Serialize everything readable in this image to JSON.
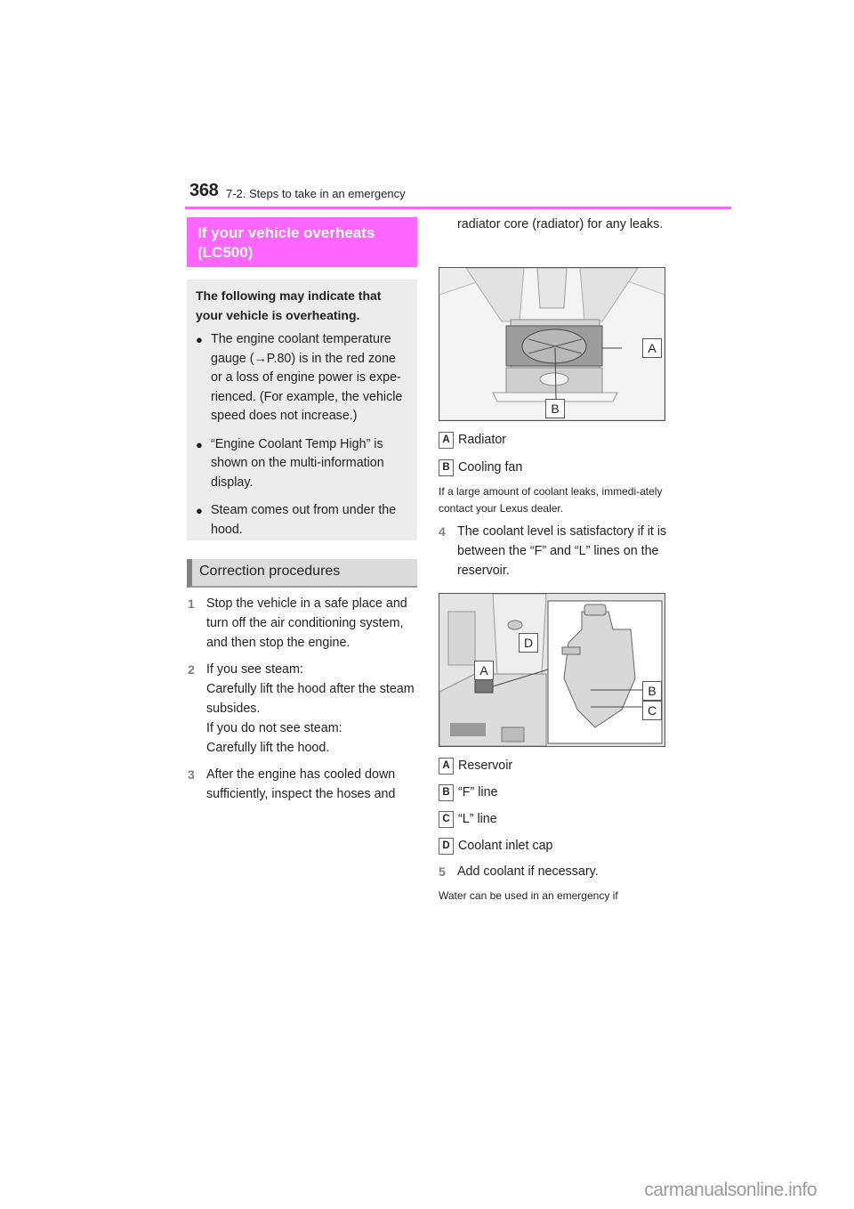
{
  "header": {
    "page_number": "368",
    "section": "7-2. Steps to take in an emergency",
    "accent_color": "#ff66ff"
  },
  "left": {
    "title": "If your vehicle overheats (LC500)",
    "title_line1": "If your vehicle overheats",
    "title_line2": "(LC500)",
    "intro": "The following may indicate that your vehicle is overheating.",
    "bullets": [
      "The engine coolant temperature gauge (→P.80) is in the red zone or a loss of engine power is expe-rienced. (For example, the vehicle speed does not increase.)",
      "“Engine Coolant Temp High” is shown on the multi-information display.",
      "Steam comes out from under the hood."
    ],
    "bullet_icon": "bullet-dot-icon",
    "subheader": "Correction procedures",
    "steps": [
      {
        "num": "1",
        "text": "Stop the vehicle in a safe place and turn off the air conditioning system, and then stop the engine."
      },
      {
        "num": "2",
        "lines": [
          "If you see steam:",
          "Carefully lift the hood after the steam subsides.",
          "If you do not see steam:",
          "Carefully lift the hood."
        ]
      },
      {
        "num": "3",
        "text": "After the engine has cooled down sufficiently, inspect the hoses and"
      }
    ]
  },
  "right": {
    "continuation": "radiator core (radiator) for any leaks.",
    "figure1": {
      "alt": "Engine bay with radiator and cooling fan",
      "callouts": [
        "A",
        "B"
      ]
    },
    "legend1": [
      {
        "key": "A",
        "label": "Radiator"
      },
      {
        "key": "B",
        "label": "Cooling fan"
      }
    ],
    "note1": "If a large amount of coolant leaks, immedi-ately contact your Lexus dealer.",
    "step4": {
      "num": "4",
      "text": "The coolant level is satisfactory if it is between the “F” and “L” lines on the reservoir."
    },
    "figure2": {
      "alt": "Coolant reservoir with F and L lines and inlet cap",
      "callouts": [
        "A",
        "B",
        "C",
        "D"
      ]
    },
    "legend2": [
      {
        "key": "A",
        "label": "Reservoir"
      },
      {
        "key": "B",
        "label": "“F” line"
      },
      {
        "key": "C",
        "label": "“L” line"
      },
      {
        "key": "D",
        "label": "Coolant inlet cap"
      }
    ],
    "step5": {
      "num": "5",
      "text": "Add coolant if necessary."
    },
    "note2": "Water can be used in an emergency if"
  },
  "footer": {
    "watermark": "carmanualsonline.info"
  }
}
